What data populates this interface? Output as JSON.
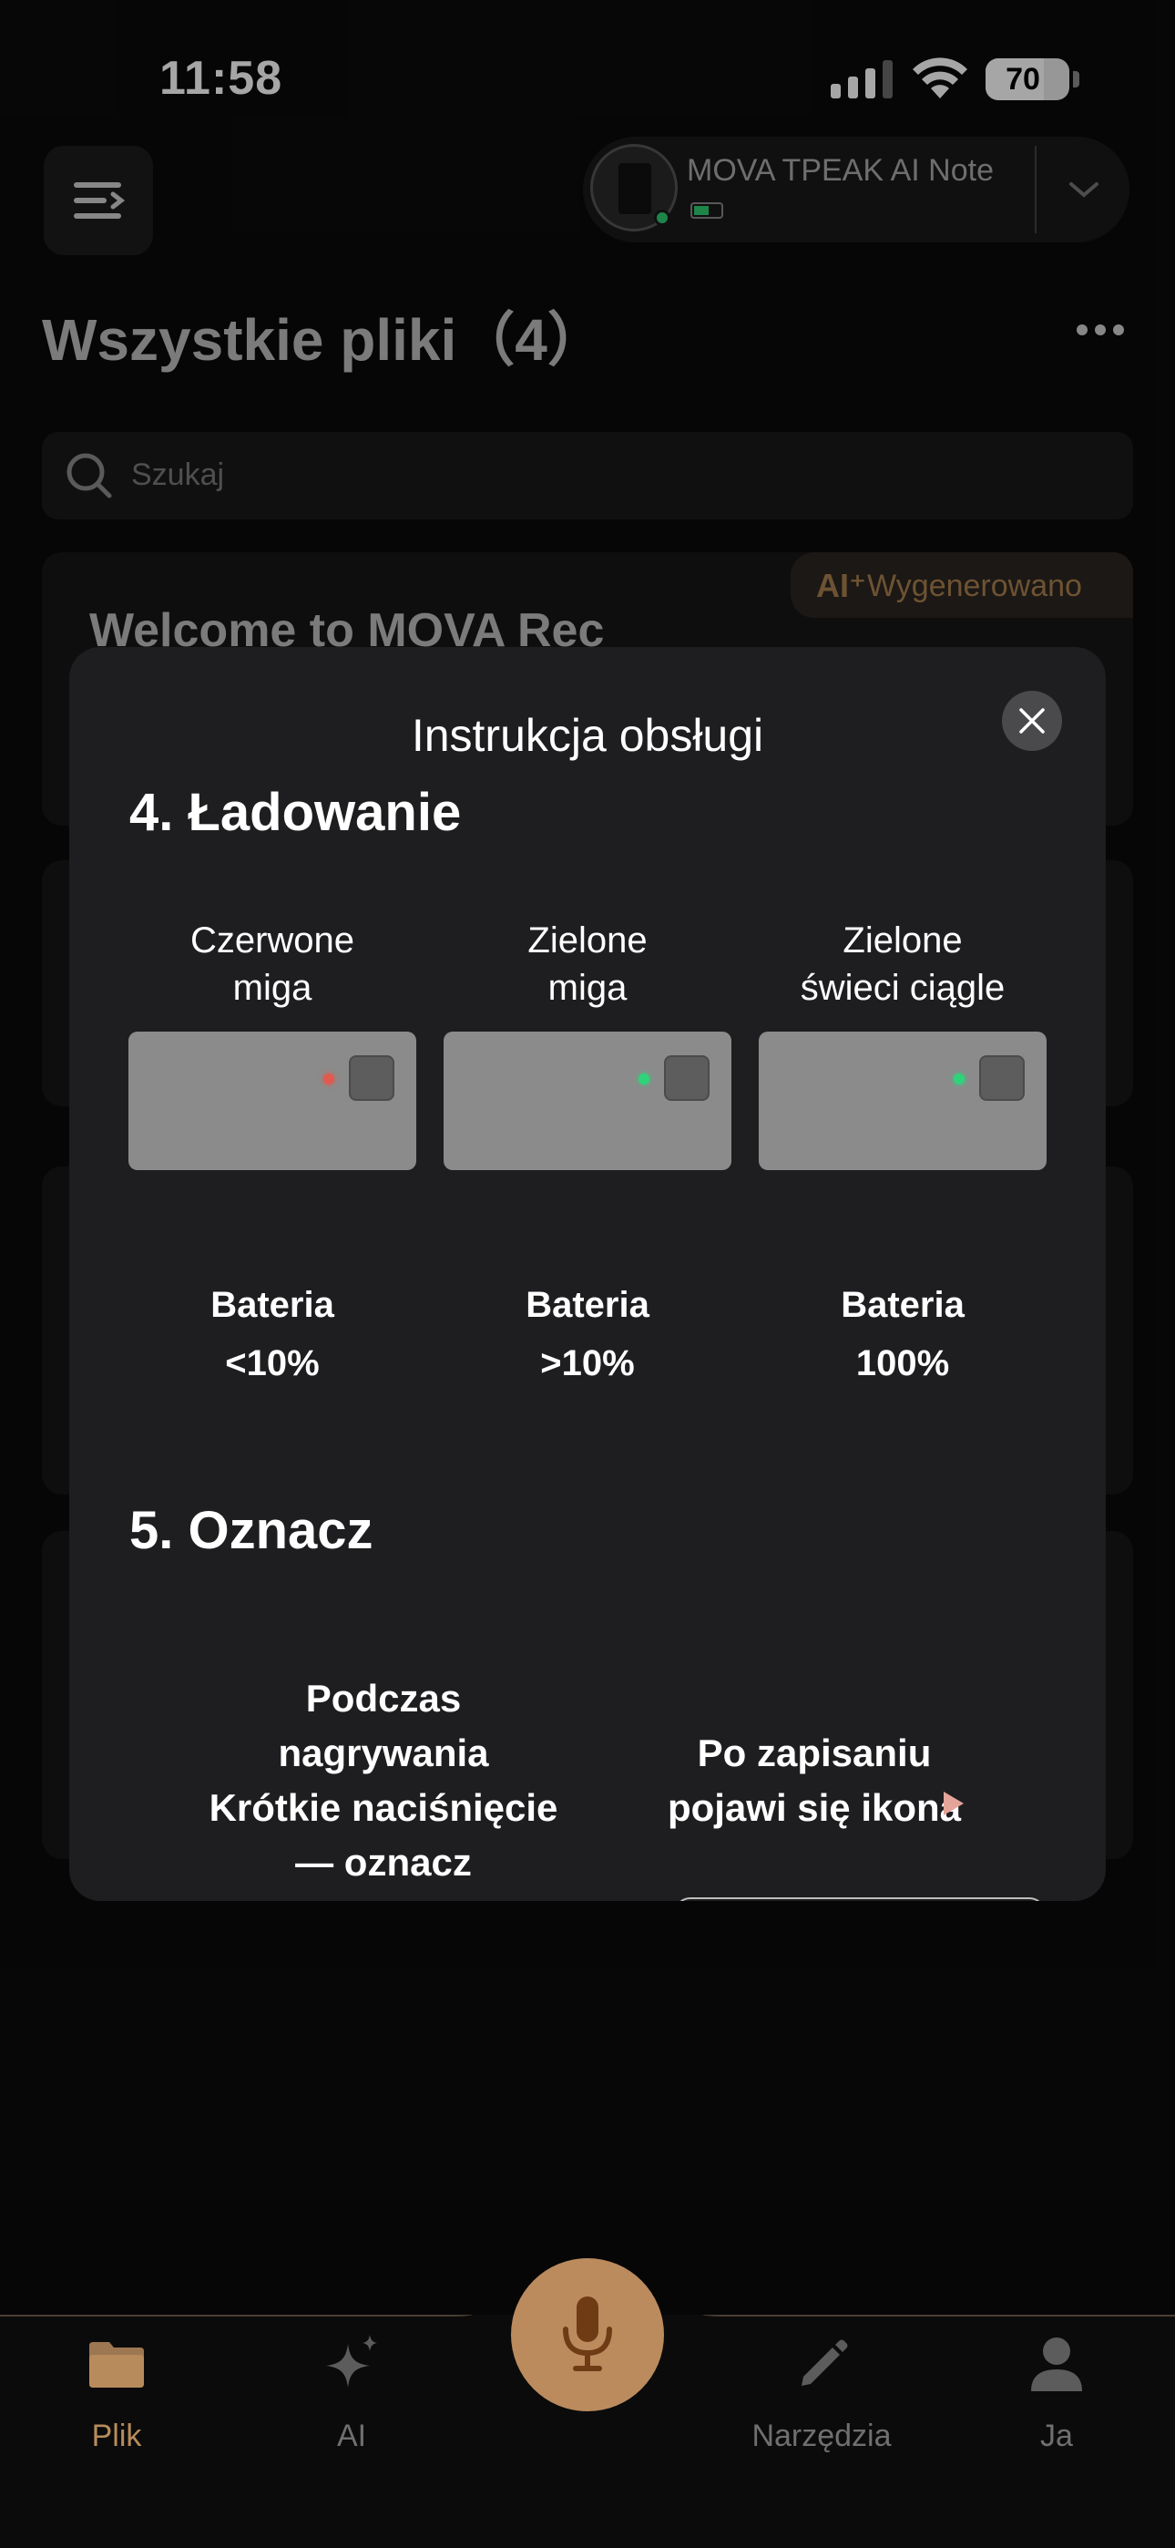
{
  "status_bar": {
    "time": "11:58",
    "battery_percent": "70",
    "battery_level": 0.7
  },
  "header": {
    "menu_icon": "menu-icon",
    "device": {
      "name": "MOVA TPEAK AI Note",
      "connected_color": "#2ecc71"
    },
    "title": "Wszystkie pliki（4）",
    "more_icon": "more-horizontal-icon"
  },
  "search": {
    "placeholder": "Szukaj"
  },
  "file_list": {
    "first_item_title": "Welcome to MOVA Rec",
    "generated_badge_icon": "AI⁺",
    "generated_badge_label": "Wygenerowano"
  },
  "modal": {
    "title": "Instrukcja obsługi",
    "close_icon": "close-icon",
    "sections": [
      {
        "heading": "4. Ładowanie",
        "states": [
          {
            "label_line1": "Czerwone",
            "label_line2": "miga",
            "led_color": "#e05a4f",
            "battery_line1": "Bateria",
            "battery_line2": "<10%"
          },
          {
            "label_line1": "Zielone",
            "label_line2": "miga",
            "led_color": "#2fd37a",
            "battery_line1": "Bateria",
            "battery_line2": ">10%"
          },
          {
            "label_line1": "Zielone",
            "label_line2": "świeci ciągle",
            "led_color": "#2fd37a",
            "battery_line1": "Bateria",
            "battery_line2": "100%"
          }
        ]
      },
      {
        "heading": "5. Oznacz",
        "left_lines": [
          "Podczas",
          "nagrywania",
          "Krótkie naciśnięcie",
          "— oznacz"
        ],
        "right_lines": [
          "Po zapisaniu",
          "pojawi się ikona"
        ],
        "mark_icon": "play-triangle-icon",
        "mark_icon_color": "#e3a49a"
      }
    ]
  },
  "bottom_nav": {
    "items": [
      {
        "label": "Plik",
        "icon": "folder-icon",
        "active": true
      },
      {
        "label": "AI",
        "icon": "sparkle-icon",
        "active": false
      },
      {
        "label": "Narzędzia",
        "icon": "pencil-icon",
        "active": false
      },
      {
        "label": "Ja",
        "icon": "person-icon",
        "active": false
      }
    ],
    "record_icon": "microphone-icon"
  },
  "colors": {
    "accent": "#bb8b5e",
    "modal_bg": "#1e1e20",
    "background": "#0a0a0a"
  }
}
